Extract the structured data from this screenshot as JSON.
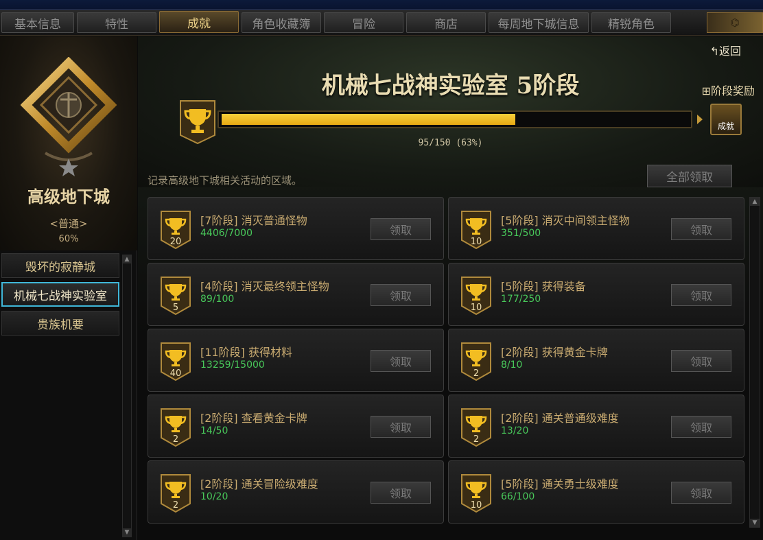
{
  "tabs": [
    {
      "label": "基本信息",
      "active": false
    },
    {
      "label": "特性",
      "active": false
    },
    {
      "label": "成就",
      "active": true
    },
    {
      "label": "角色收藏簿",
      "active": false
    },
    {
      "label": "冒险",
      "active": false
    },
    {
      "label": "商店",
      "active": false
    },
    {
      "label": "每周地下城信息",
      "active": false
    },
    {
      "label": "精锐角色",
      "active": false
    }
  ],
  "sidebar": {
    "dungeon_name": "高级地下城",
    "difficulty": "<普通>",
    "percent": "60%",
    "items": [
      {
        "label": "毁坏的寂静城",
        "active": false
      },
      {
        "label": "机械七战神实验室",
        "active": true
      },
      {
        "label": "贵族机要",
        "active": false
      }
    ]
  },
  "header": {
    "return_label": "返回",
    "stage_title": "机械七战神实验室 5阶段",
    "reward_label": "阶段奖励",
    "reward_box_label": "成就",
    "progress_text": "95/150 (63%)",
    "progress_fraction": 0.63
  },
  "description": "记录高级地下城相关活动的区域。",
  "claim_all_label": "全部领取",
  "achievements": [
    {
      "stage": "[7阶段]",
      "title": "消灭普通怪物",
      "progress": "4406/7000",
      "points": "20",
      "claim": "领取"
    },
    {
      "stage": "[5阶段]",
      "title": "消灭中间领主怪物",
      "progress": "351/500",
      "points": "10",
      "claim": "领取"
    },
    {
      "stage": "[4阶段]",
      "title": "消灭最终领主怪物",
      "progress": "89/100",
      "points": "5",
      "claim": "领取"
    },
    {
      "stage": "[5阶段]",
      "title": "获得装备",
      "progress": "177/250",
      "points": "10",
      "claim": "领取"
    },
    {
      "stage": "[11阶段]",
      "title": "获得材料",
      "progress": "13259/15000",
      "points": "40",
      "claim": "领取"
    },
    {
      "stage": "[2阶段]",
      "title": "获得黄金卡牌",
      "progress": "8/10",
      "points": "2",
      "claim": "领取"
    },
    {
      "stage": "[2阶段]",
      "title": "查看黄金卡牌",
      "progress": "14/50",
      "points": "2",
      "claim": "领取"
    },
    {
      "stage": "[2阶段]",
      "title": "通关普通级难度",
      "progress": "13/20",
      "points": "2",
      "claim": "领取"
    },
    {
      "stage": "[2阶段]",
      "title": "通关冒险级难度",
      "progress": "10/20",
      "points": "2",
      "claim": "领取"
    },
    {
      "stage": "[5阶段]",
      "title": "通关勇士级难度",
      "progress": "66/100",
      "points": "10",
      "claim": "领取"
    }
  ],
  "colors": {
    "accent_gold": "#f1d58a",
    "progress_fill": "#f2bd22",
    "progress_green": "#48c85a",
    "active_border": "#3fb7d8"
  }
}
